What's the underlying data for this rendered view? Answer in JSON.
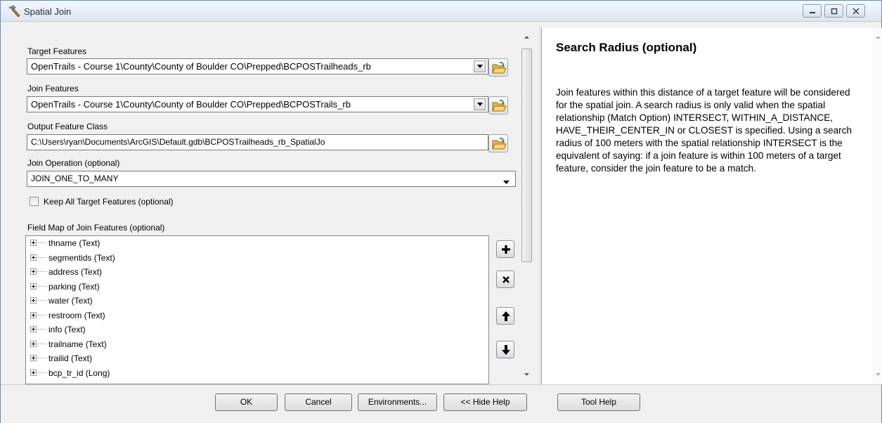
{
  "window": {
    "title": "Spatial Join"
  },
  "form": {
    "target_features": {
      "label": "Target Features",
      "value": "OpenTrails - Course 1\\County\\County of Boulder CO\\Prepped\\BCPOSTrailheads_rb"
    },
    "join_features": {
      "label": "Join Features",
      "value": "OpenTrails - Course 1\\County\\County of Boulder CO\\Prepped\\BCPOSTrails_rb"
    },
    "output_feature_class": {
      "label": "Output Feature Class",
      "value": "C:\\Users\\ryan\\Documents\\ArcGIS\\Default.gdb\\BCPOSTrailheads_rb_SpatialJo"
    },
    "join_operation": {
      "label": "Join Operation (optional)",
      "value": "JOIN_ONE_TO_MANY"
    },
    "keep_all": {
      "label": "Keep All Target Features (optional)",
      "checked": false
    },
    "field_map": {
      "label": "Field Map of Join Features (optional)",
      "items": [
        "thname (Text)",
        "segmentids (Text)",
        "address (Text)",
        "parking (Text)",
        "water (Text)",
        "restroom (Text)",
        "info (Text)",
        "trailname (Text)",
        "trailid (Text)",
        "bcp_tr_id (Long)"
      ]
    }
  },
  "help": {
    "title": "Search Radius (optional)",
    "body": "Join features within this distance of a target feature will be considered for the spatial join. A search radius is only valid when the spatial relationship (Match Option) INTERSECT, WITHIN_A_DISTANCE, HAVE_THEIR_CENTER_IN or CLOSEST is specified. Using a search radius of 100 meters with the spatial relationship INTERSECT is the equivalent of saying: if a join feature is within 100 meters of a target feature, consider the join feature to be a match."
  },
  "buttons": {
    "ok": "OK",
    "cancel": "Cancel",
    "environments": "Environments...",
    "hide_help": "<< Hide Help",
    "tool_help": "Tool Help"
  },
  "icons": {
    "title": "hammer-icon",
    "browse": "open-folder-icon",
    "add": "plus-icon",
    "remove": "x-icon",
    "up": "arrow-up-icon",
    "down": "arrow-down-icon"
  }
}
